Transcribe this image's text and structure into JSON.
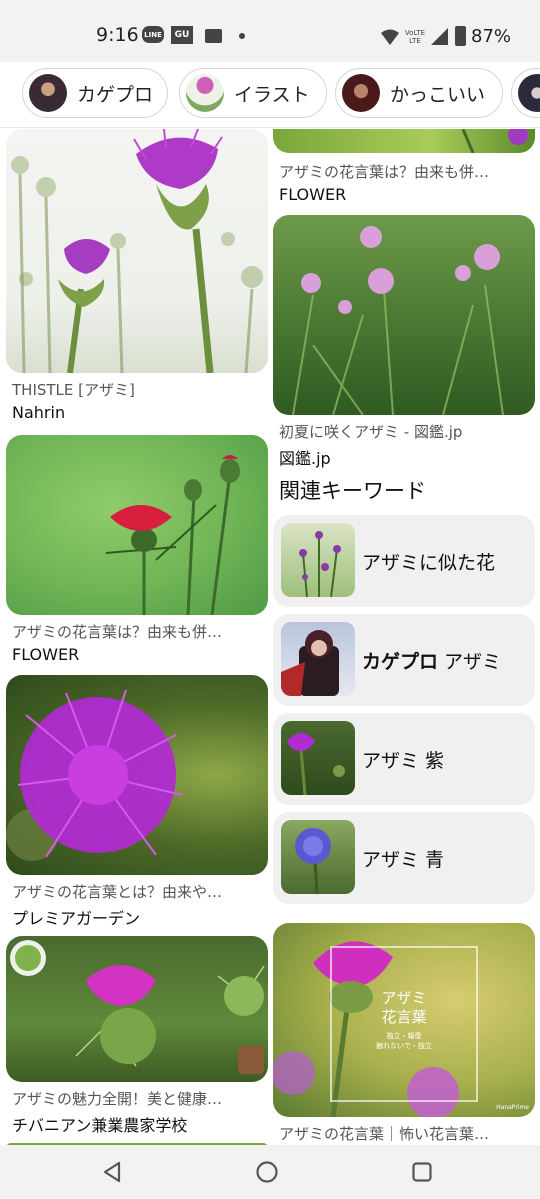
{
  "status_bar": {
    "time": "9:16",
    "line_badge": "LINE",
    "gu_badge": "GU",
    "volte_top": "VoLTE",
    "volte_bottom": "LTE",
    "battery_pct": "87%"
  },
  "chips": [
    {
      "label": "カゲプロ",
      "thumb_color": "#3a2a33"
    },
    {
      "label": "イラスト",
      "thumb_color": "#d6e3c9"
    },
    {
      "label": "かっこいい",
      "thumb_color": "#4a1a1a"
    },
    {
      "label": "",
      "thumb_color": "#2a2a3a"
    }
  ],
  "feed": {
    "left_column": [
      {
        "caption": "THISTLE [アザミ]",
        "source": "Nahrin"
      },
      {
        "caption": "アザミの花言葉は？由来も併…",
        "source": "FLOWER"
      },
      {
        "caption": "アザミの花言葉とは？由来や…",
        "source": "プレミアガーデン"
      },
      {
        "caption": "アザミの魅力全開！美と健康…",
        "source": "チバニアン兼業農家学校"
      }
    ],
    "right_column": [
      {
        "caption": "アザミの花言葉は？由来も併…",
        "source": "FLOWER"
      },
      {
        "caption": "初夏に咲くアザミ - 図鑑.jp",
        "source": "図鑑.jp"
      },
      {
        "caption": "アザミの花言葉｜怖い花言葉…",
        "source": ""
      }
    ],
    "overlay_title_line1": "アザミ",
    "overlay_title_line2": "花言葉",
    "overlay_sub1": "独立・報復",
    "overlay_sub2": "触れないで・独立",
    "overlay_brand": "HanaPrime"
  },
  "related_keywords": {
    "title": "関連キーワード",
    "items": [
      {
        "bold": "",
        "text": "アザミに似た花"
      },
      {
        "bold": "カゲプロ",
        "text": " アザミ"
      },
      {
        "bold": "",
        "text": "アザミ 紫"
      },
      {
        "bold": "",
        "text": "アザミ 青"
      }
    ]
  },
  "colors": {
    "status_bg": "#f2f2f2",
    "chip_border": "#d4d4d4",
    "keyword_bg": "#f0f0f0",
    "thistle_purple": "#b02bd0",
    "thistle_red": "#d81e3c"
  },
  "icons": [
    "line-icon",
    "gu-icon",
    "tv-icon",
    "wifi-icon",
    "volte-icon",
    "signal-icon",
    "battery-icon",
    "back-icon",
    "home-icon",
    "recents-icon"
  ]
}
